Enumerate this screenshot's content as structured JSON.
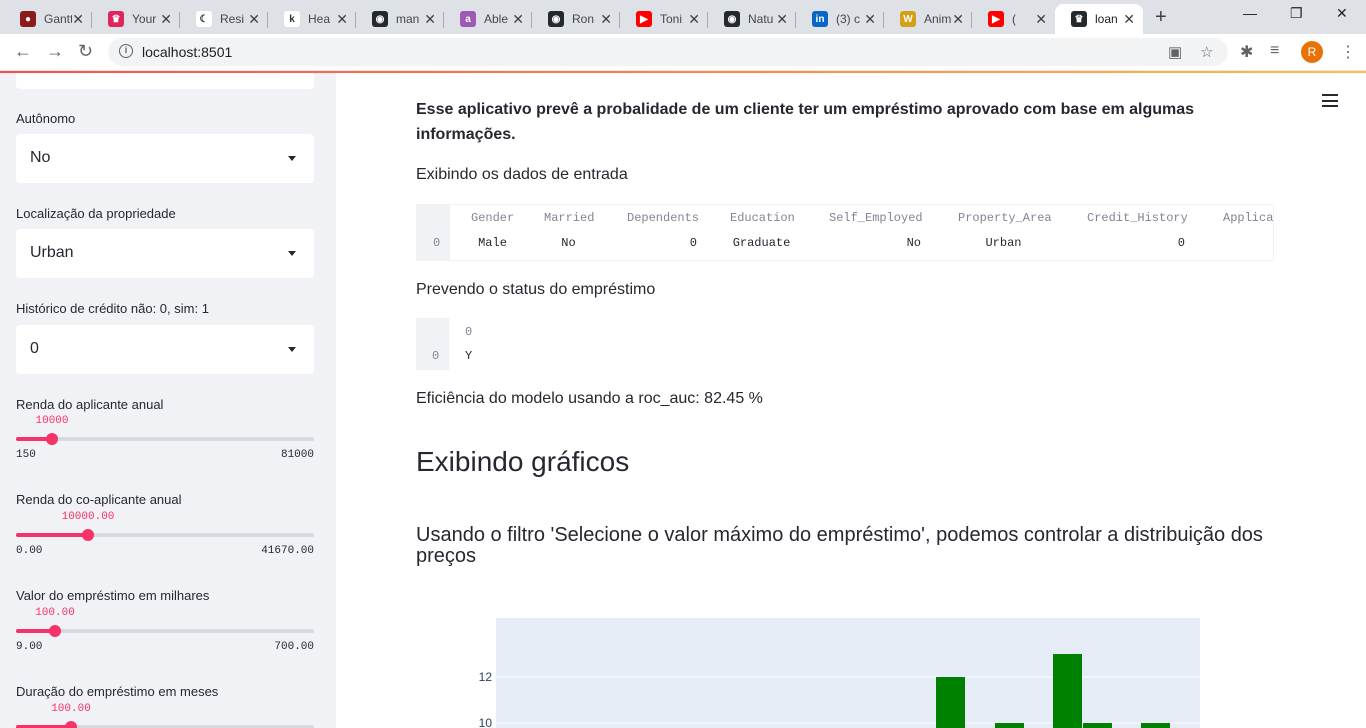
{
  "browser": {
    "tabs": [
      {
        "title": "Gantt",
        "color": "#8b1a1a",
        "glyph": "●"
      },
      {
        "title": "Your",
        "color": "#e0245e",
        "glyph": "♛"
      },
      {
        "title": "Resi",
        "color": "#ffffff",
        "glyph": "☾"
      },
      {
        "title": "Hea",
        "color": "#ffffff",
        "glyph": "k"
      },
      {
        "title": "man",
        "color": "#24292e",
        "glyph": "◉"
      },
      {
        "title": "Able",
        "color": "#9c5ab5",
        "glyph": "a"
      },
      {
        "title": "Ron",
        "color": "#24292e",
        "glyph": "◉"
      },
      {
        "title": "Toni",
        "color": "#ff0000",
        "glyph": "▶"
      },
      {
        "title": "Natu",
        "color": "#24292e",
        "glyph": "◉"
      },
      {
        "title": "(3) c",
        "color": "#0a66c2",
        "glyph": "in"
      },
      {
        "title": "Anim",
        "color": "#d4a017",
        "glyph": "W"
      },
      {
        "title": "(",
        "color": "#ff0000",
        "glyph": "▶"
      },
      {
        "title": "loan",
        "color": "#24292e",
        "glyph": "♛"
      }
    ],
    "url": "localhost:8501",
    "profile_initial": "R",
    "new_tab": "+"
  },
  "sidebar": {
    "autonomo": {
      "label": "Autônomo",
      "value": "No"
    },
    "localizacao": {
      "label": "Localização da propriedade",
      "value": "Urban"
    },
    "historico": {
      "label": "Histórico de crédito não: 0, sim: 1",
      "value": "0"
    },
    "sliders": [
      {
        "label": "Renda do aplicante anual",
        "value": "10000",
        "min": "150",
        "max": "81000",
        "fraction": 0.12
      },
      {
        "label": "Renda do co-aplicante anual",
        "value": "10000.00",
        "min": "0.00",
        "max": "41670.00",
        "fraction": 0.24
      },
      {
        "label": "Valor do empréstimo em milhares",
        "value": "100.00",
        "min": "9.00",
        "max": "700.00",
        "fraction": 0.13
      },
      {
        "label": "Duração do empréstimo em meses",
        "value": "100.00",
        "min": "",
        "max": "",
        "fraction": 0.185
      }
    ]
  },
  "main": {
    "intro": "Esse aplicativo prevê a probalidade de um cliente ter um empréstimo aprovado com base em algumas informações.",
    "input_heading": "Exibindo os dados de entrada",
    "input_table": {
      "columns": [
        "Gender",
        "Married",
        "Dependents",
        "Education",
        "Self_Employed",
        "Property_Area",
        "Credit_History",
        "Applica"
      ],
      "index": "0",
      "row": [
        "Male",
        "No",
        "0",
        "Graduate",
        "No",
        "Urban",
        "0",
        ""
      ]
    },
    "prediction_heading": "Prevendo o status do empréstimo",
    "prediction_table": {
      "column": "0",
      "index": "0",
      "value": "Y"
    },
    "efficiency": "Eficiência do modelo usando a roc_auc: 82.45 %",
    "charts_heading": "Exibindo gráficos",
    "chart_subheading": "Usando o filtro 'Selecione o valor máximo do empréstimo', podemos controlar a distribuição dos preços"
  },
  "chart_data": {
    "type": "bar",
    "ytick_labels": [
      "12",
      "10"
    ],
    "bars": [
      {
        "x": 0,
        "y": 12
      },
      {
        "x": 1,
        "y": 10
      },
      {
        "x": 2,
        "y": 13
      },
      {
        "x": 3,
        "y": 10
      },
      {
        "x": 4,
        "y": 10
      }
    ],
    "bar_color": "#008000",
    "plot_bg": "#e5ecf6"
  }
}
